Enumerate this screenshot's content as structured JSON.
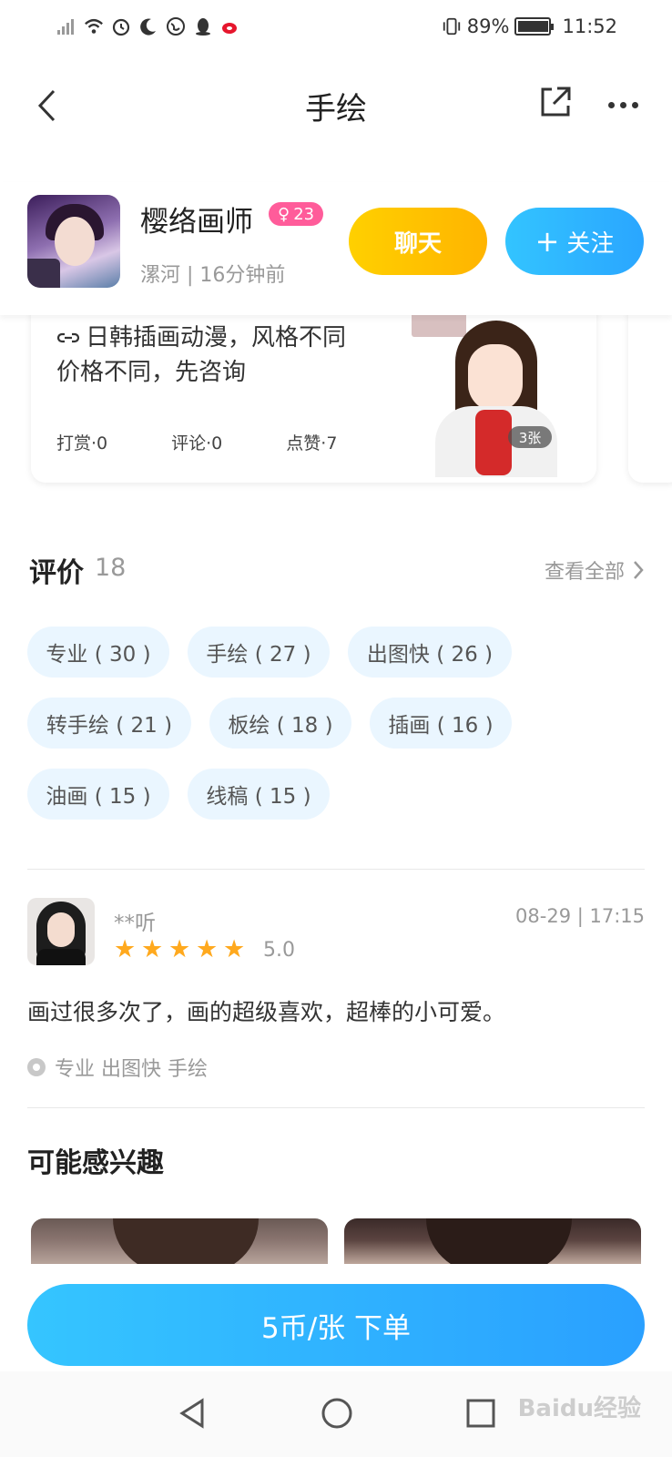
{
  "status_bar": {
    "battery": "89%",
    "battery_level": 0.89,
    "time": "11:52"
  },
  "nav": {
    "title": "手绘"
  },
  "profile": {
    "name": "樱络画师",
    "gender_symbol": "♀",
    "age": "23",
    "location": "漯河 | 16分钟前",
    "chat_label": "聊天",
    "follow_label": "关注",
    "follow_plus": "+"
  },
  "post": {
    "text": "日韩插画动漫，风格不同价格不同，先咨询",
    "stats": {
      "tips": "打赏·0",
      "comments": "评论·0",
      "likes": "点赞·7"
    },
    "image_count": "3张"
  },
  "reviews": {
    "title": "评价",
    "count": "18",
    "see_all": "查看全部",
    "tags": [
      "专业 ( 30 )",
      "手绘 ( 27 )",
      "出图快 ( 26 )",
      "转手绘 ( 21 )",
      "板绘 ( 18 )",
      "插画 ( 16 )",
      "油画 ( 15 )",
      "线稿 ( 15 )"
    ],
    "item": {
      "reviewer": "**听",
      "date": "08-29 | 17:15",
      "rating": 5,
      "score": "5.0",
      "text": "画过很多次了，画的超级喜欢，超棒的小可爱。",
      "tags": "专业 出图快 手绘"
    }
  },
  "interest": {
    "title": "可能感兴趣"
  },
  "order": {
    "label": "5币/张 下单"
  },
  "watermark": "Baidu经验",
  "colors": {
    "chat_yellow": "#ffc400",
    "follow_blue": "#2aa6ff",
    "tag_bg": "#eaf6ff",
    "star_orange": "#ffa91e",
    "age_pink": "#ff5c9a"
  }
}
